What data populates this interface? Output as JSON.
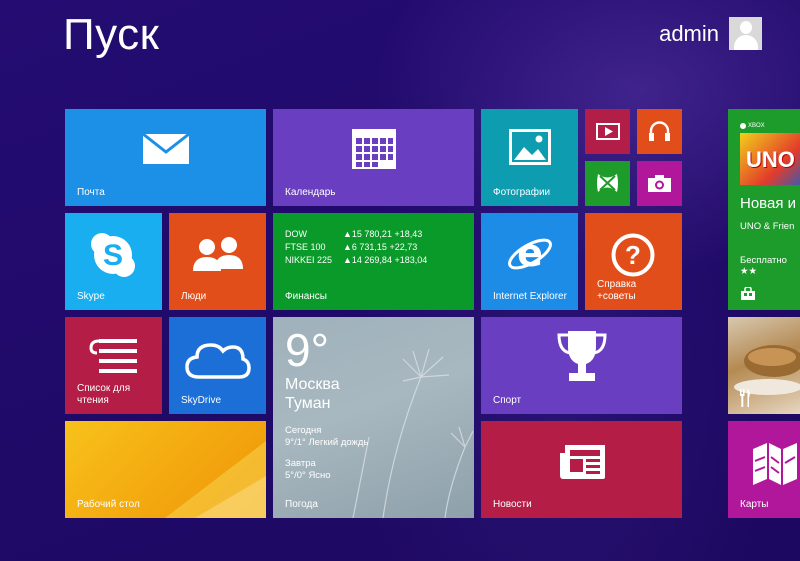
{
  "header": {
    "title": "Пуск",
    "user_name": "admin"
  },
  "tiles": {
    "mail": {
      "label": "Почта",
      "color": "#1c8fe6"
    },
    "calendar": {
      "label": "Календарь",
      "color": "#6a3ec1"
    },
    "photos": {
      "label": "Фотографии",
      "color": "#0e9cb0"
    },
    "video": {
      "color": "#b21e48"
    },
    "music": {
      "color": "#e24e1a"
    },
    "games": {
      "color": "#1d9c2b"
    },
    "camera": {
      "color": "#b1179a"
    },
    "skype": {
      "label": "Skype",
      "color": "#18aef0"
    },
    "people": {
      "label": "Люди",
      "color": "#e24e1a"
    },
    "finance": {
      "label": "Финансы",
      "color": "#0a9a2a",
      "rows": [
        {
          "name": "DOW",
          "value": "▲15 780,21 +18,43"
        },
        {
          "name": "FTSE 100",
          "value": "▲6 731,15 +22,73"
        },
        {
          "name": "NIKKEI 225",
          "value": "▲14 269,84 +183,04"
        }
      ]
    },
    "ie": {
      "label": "Internet Explorer",
      "color": "#1d8ce6"
    },
    "help": {
      "label_line1": "Справка",
      "label_line2": "+советы",
      "color": "#e24e1a"
    },
    "readinglist": {
      "label_line1": "Список для",
      "label_line2": "чтения",
      "color": "#b41d46"
    },
    "skydrive": {
      "label": "SkyDrive",
      "color": "#1d6fd8"
    },
    "weather": {
      "label": "Погода",
      "temp": "9°",
      "city": "Москва",
      "condition": "Туман",
      "today_label": "Сегодня",
      "today_forecast": "9°/1° Легкий дождь",
      "tomorrow_label": "Завтра",
      "tomorrow_forecast": "5°/0° Ясно"
    },
    "sport": {
      "label": "Спорт",
      "color": "#6a3ec1"
    },
    "desktop": {
      "label": "Рабочий стол"
    },
    "news": {
      "label": "Новости",
      "color": "#b41d46"
    },
    "store": {
      "color": "#1d9c2b",
      "badge": "XBOX",
      "heading": "Новая и",
      "app": "UNO & Frien",
      "price": "Бесплатно ★★",
      "game_logo": "UNO"
    },
    "maps": {
      "label": "Карты",
      "color": "#b1179a"
    }
  }
}
